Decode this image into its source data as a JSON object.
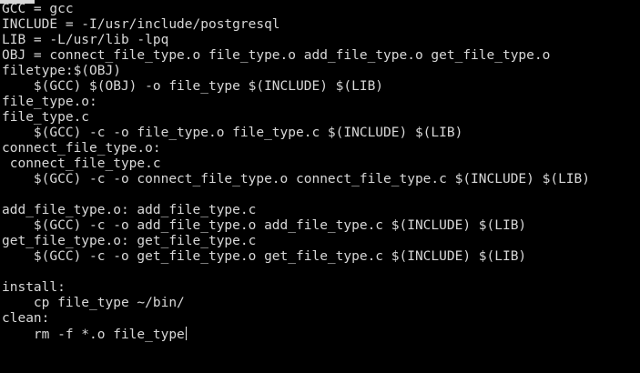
{
  "editor": {
    "lines": [
      "GCC = gcc",
      "INCLUDE = -I/usr/include/postgresql",
      "LIB = -L/usr/lib -lpq",
      "OBJ = connect_file_type.o file_type.o add_file_type.o get_file_type.o",
      "filetype:$(OBJ)",
      "    $(GCC) $(OBJ) -o file_type $(INCLUDE) $(LIB)",
      "file_type.o:",
      "file_type.c",
      "    $(GCC) -c -o file_type.o file_type.c $(INCLUDE) $(LIB)",
      "connect_file_type.o:",
      " connect_file_type.c",
      "    $(GCC) -c -o connect_file_type.o connect_file_type.c $(INCLUDE) $(LIB)",
      "",
      "add_file_type.o: add_file_type.c",
      "    $(GCC) -c -o add_file_type.o add_file_type.c $(INCLUDE) $(LIB)",
      "get_file_type.o: get_file_type.c",
      "    $(GCC) -c -o get_file_type.o get_file_type.c $(INCLUDE) $(LIB)",
      "",
      "install:",
      "    cp file_type ~/bin/",
      "clean:",
      "    rm -f *.o file_type"
    ],
    "cursor_line": 21
  },
  "colors": {
    "background": "#000000",
    "text": "#d8d8d8",
    "cursor": "#e8e8e8"
  }
}
